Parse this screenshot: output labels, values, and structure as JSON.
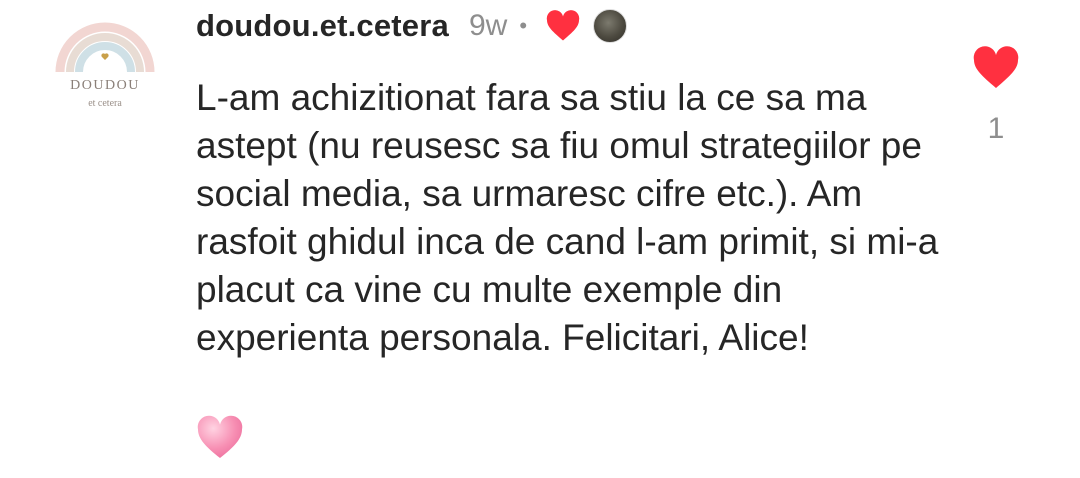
{
  "comment": {
    "author": {
      "username": "doudou.et.cetera",
      "avatar_brand": "DOUDOU",
      "avatar_sub": "et cetera"
    },
    "timestamp": "9w",
    "separator": "•",
    "liked_by_author": true,
    "text": "L-am achizitionat fara sa stiu la ce sa ma astept (nu reusesc sa fiu omul strategiilor pe social media, sa urmaresc cifre etc.). Am rasfoit ghidul inca de cand l-am primit, si mi-a placut ca vine cu multe exemple din experienta personala. Felicitari, Alice!",
    "trailing_emoji": "pink-heart",
    "like_count": "1",
    "liked": true
  },
  "colors": {
    "heart_red": "#ff3040",
    "pink_heart": "#f78fb3",
    "text": "#262626",
    "muted": "#8e8e8e"
  },
  "icons": [
    "heart-icon",
    "pink-heart-emoji",
    "avatar-rainbow-logo"
  ]
}
